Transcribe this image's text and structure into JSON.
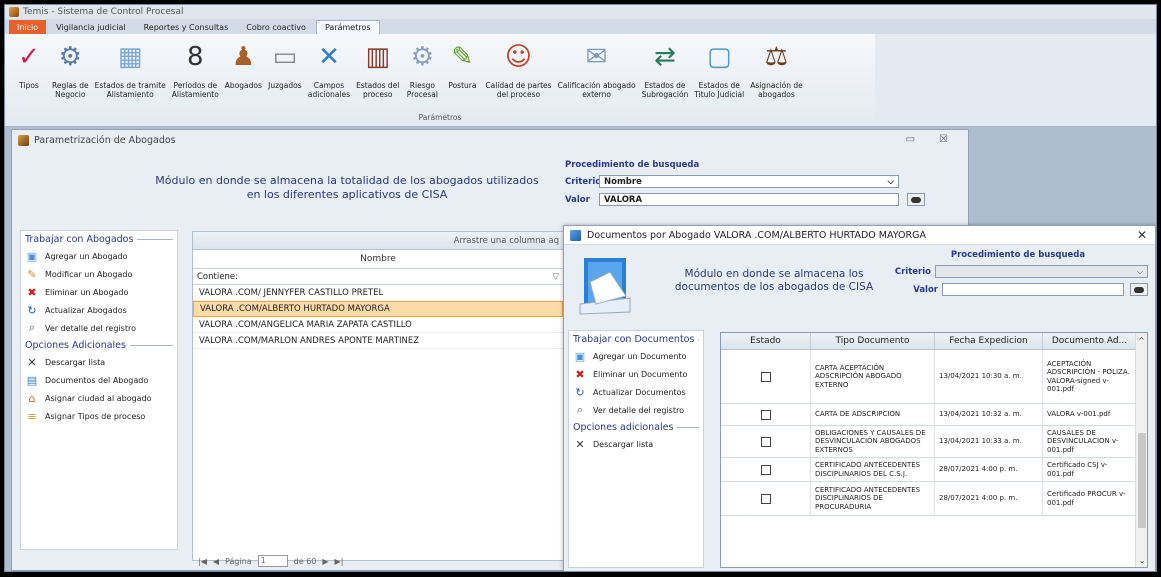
{
  "app": {
    "title": "Temis - Sistema de Control Procesal"
  },
  "tabs": [
    {
      "label": "Inicio"
    },
    {
      "label": "Vigilancia judicial"
    },
    {
      "label": "Reportes y Consultas"
    },
    {
      "label": "Cobro coactivo"
    },
    {
      "label": "Parámetros"
    }
  ],
  "ribbon": {
    "group_label": "Parámetros",
    "buttons": [
      {
        "label": "Tipos",
        "icon": "tipos-icon"
      },
      {
        "label": "Reglas de\nNegocio",
        "icon": "reglas-icon"
      },
      {
        "label": "Estados de tramite\nAlistamiento",
        "icon": "estados-tramite-icon"
      },
      {
        "label": "Periodos de\nAlistamiento",
        "icon": "calendar-icon"
      },
      {
        "label": "Abogados",
        "icon": "abogados-icon"
      },
      {
        "label": "Juzgados",
        "icon": "juzgados-icon"
      },
      {
        "label": "Campos\nadicionales",
        "icon": "tools-icon"
      },
      {
        "label": "Estados del\nproceso",
        "icon": "books-icon"
      },
      {
        "label": "Riesgo\nProcesal",
        "icon": "riesgo-icon"
      },
      {
        "label": "Postura",
        "icon": "postura-icon"
      },
      {
        "label": "Calidad de partes\ndel proceso",
        "icon": "calidad-icon"
      },
      {
        "label": "Calificación abogado\nexterno",
        "icon": "calificacion-icon"
      },
      {
        "label": "Estados de\nSubrogación",
        "icon": "subrogacion-icon"
      },
      {
        "label": "Estados de\nTitulo Judicial",
        "icon": "titulo-icon"
      },
      {
        "label": "Asignación de\nabogados",
        "icon": "asignacion-icon"
      }
    ]
  },
  "win1": {
    "title": "Parametrización de Abogados",
    "minimize": "▭",
    "close": "☒",
    "description": "Módulo en donde se almacena la totalidad de los abogados utilizados en los diferentes aplicativos de CISA",
    "search": {
      "title": "Procedimiento de busqueda",
      "criterio_label": "Criterio",
      "criterio_value": "Nombre",
      "valor_label": "Valor",
      "valor_value": "VALORA"
    },
    "left": {
      "section1": "Trabajar con Abogados",
      "items1": [
        {
          "label": "Agregar un Abogado",
          "icon": "add-icon"
        },
        {
          "label": "Modificar un Abogado",
          "icon": "edit-icon"
        },
        {
          "label": "Eliminar un Abogado",
          "icon": "delete-icon"
        },
        {
          "label": "Actualizar Abogados",
          "icon": "refresh-icon"
        },
        {
          "label": "Ver detalle del registro",
          "icon": "detail-icon"
        }
      ],
      "section2": "Opciones Adicionales",
      "items2": [
        {
          "label": "Descargar lista",
          "icon": "download-icon"
        },
        {
          "label": "Documentos del Abogado",
          "icon": "documents-icon"
        },
        {
          "label": "Asignar ciudad al abogado",
          "icon": "city-icon"
        },
        {
          "label": "Asignar Tipos de proceso",
          "icon": "process-icon"
        }
      ]
    },
    "grid": {
      "group_hint": "Arrastre una columna aq",
      "column": "Nombre",
      "filter_label": "Contiene:",
      "rows": [
        "VALORA .COM/ JENNYFER CASTILLO PRETEL",
        "VALORA .COM/ALBERTO HURTADO MAYORGA",
        "VALORA .COM/ANGELICA MARIA ZAPATA CASTILLO",
        "VALORA .COM/MARLON ANDRES APONTE MARTINEZ"
      ],
      "selected_index": 1
    },
    "pager": {
      "first": "|◀",
      "prev": "◀",
      "label": "Página",
      "page": "1",
      "of": "de 60",
      "next": "▶",
      "last": "▶|"
    }
  },
  "win2": {
    "title": "Documentos por Abogado VALORA .COM/ALBERTO HURTADO MAYORGA",
    "close": "✕",
    "description": "Módulo en donde se almacena los documentos de los abogados de CISA",
    "search": {
      "title": "Procedimiento de busqueda",
      "criterio_label": "Criterio",
      "valor_label": "Valor"
    },
    "left": {
      "section1": "Trabajar con Documentos",
      "items1": [
        {
          "label": "Agregar un Documento",
          "icon": "add-icon"
        },
        {
          "label": "Eliminar un Documento",
          "icon": "delete-icon"
        },
        {
          "label": "Actualizar Documentos",
          "icon": "refresh-icon"
        },
        {
          "label": "Ver detalle del registro",
          "icon": "detail-icon"
        }
      ],
      "section2": "Opciones adicionales",
      "items2": [
        {
          "label": "Descargar lista",
          "icon": "download-icon"
        }
      ]
    },
    "grid": {
      "headers": [
        "Estado",
        "Tipo Documento",
        "Fecha Expedicion",
        "Documento Ad..."
      ],
      "rows": [
        {
          "tipo": "CARTA ACEPTACIÓN ADSCRIPCIÓN ABOGADO EXTERNO",
          "fecha": "13/04/2021 10:30 a. m.",
          "doc": "ACEPTACIÓN ADSCRIPCIÓN - POLIZA. VALORA-signed v-001.pdf"
        },
        {
          "tipo": "CARTA DE ADSCRIPCION",
          "fecha": "13/04/2021 10:32 a. m.",
          "doc": "VALORA v-001.pdf"
        },
        {
          "tipo": "OBLIGACIONES Y CAUSALES DE DESVINCULACIÓN ABOGADOS EXTERNOS",
          "fecha": "13/04/2021 10:33 a. m.",
          "doc": "CAUSALES DE DESVINCULACION v-001.pdf"
        },
        {
          "tipo": "CERTIFICADO ANTECEDENTES DISCIPLINARIOS DEL C.S.J.",
          "fecha": "28/07/2021 4:00 p. m.",
          "doc": "Certificado CSJ v-001.pdf"
        },
        {
          "tipo": "CERTIFICADO ANTECEDENTES DISCIPLINARIOS DE PROCURADURIA",
          "fecha": "28/07/2021 4:00 p. m.",
          "doc": "Certificado PROCUR v-001.pdf"
        }
      ]
    }
  },
  "colors": {
    "accent": "#e7612d",
    "heading": "#2a3a8a",
    "selection": "#fcdba8"
  }
}
